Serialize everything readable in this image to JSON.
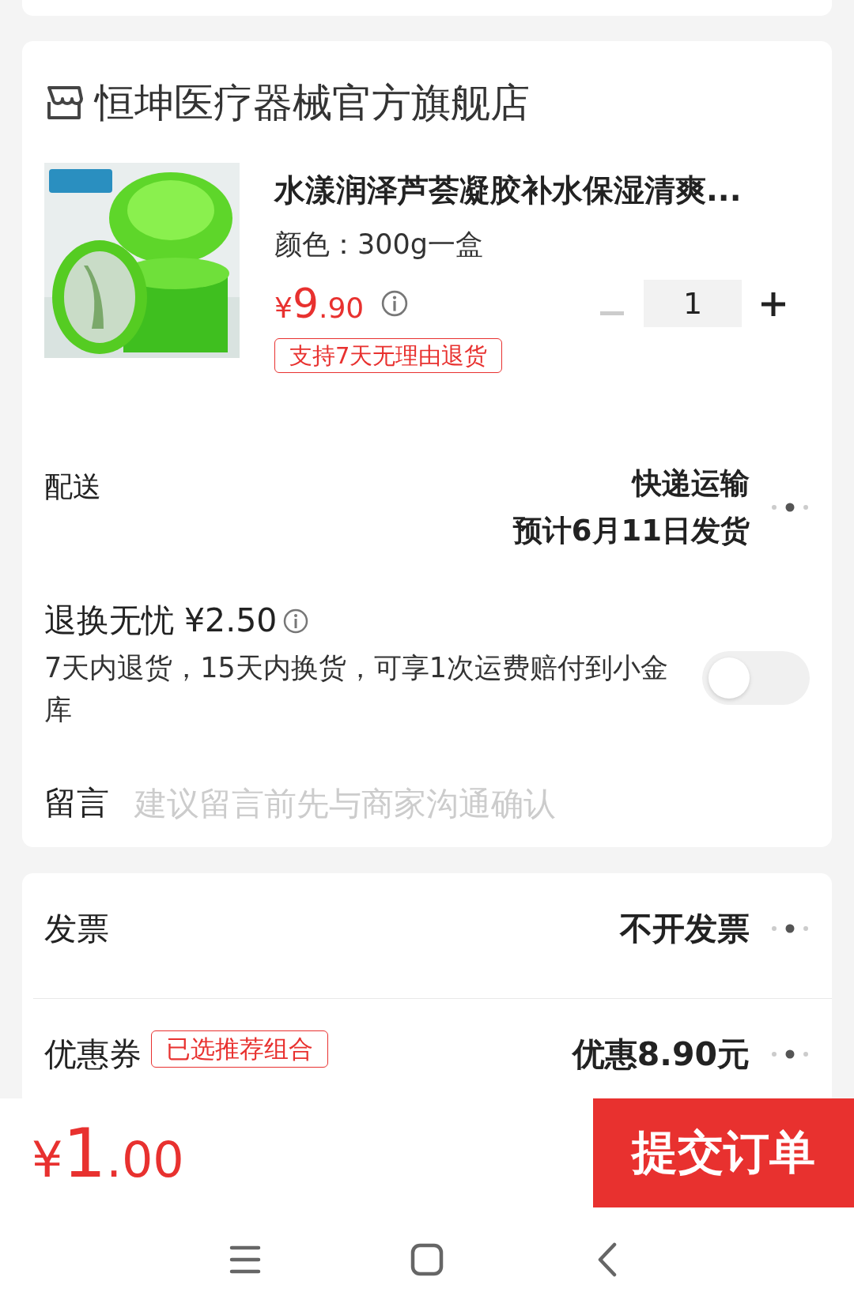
{
  "store": {
    "name": "恒坤医疗器械官方旗舰店"
  },
  "product": {
    "kind": "picture",
    "title": "水漾润泽芦荟凝胶补水保湿清爽...",
    "spec": "颜色：300g一盒",
    "price": {
      "symbol": "¥",
      "whole": "9",
      "fraction": ".90"
    },
    "quantity": {
      "value": "1",
      "decrement_disabled": true
    },
    "tag": "支持7天无理由退货"
  },
  "delivery": {
    "label": "配送",
    "method": "快递运输",
    "eta": "预计6月11日发货"
  },
  "insurance": {
    "title": "退换无忧 ¥2.50",
    "description": "7天内退货，15天内换货，可享1次运费赔付到小金库",
    "on": false
  },
  "message": {
    "label": "留言",
    "placeholder": "建议留言前先与商家沟通确认"
  },
  "invoice": {
    "label": "发票",
    "value": "不开发票"
  },
  "coupon": {
    "label": "优惠券",
    "tag": "已选推荐组合",
    "value": "优惠8.90元"
  },
  "footer": {
    "total": {
      "symbol": "¥",
      "whole": "1",
      "fraction": ".00"
    },
    "submit": "提交订单"
  }
}
